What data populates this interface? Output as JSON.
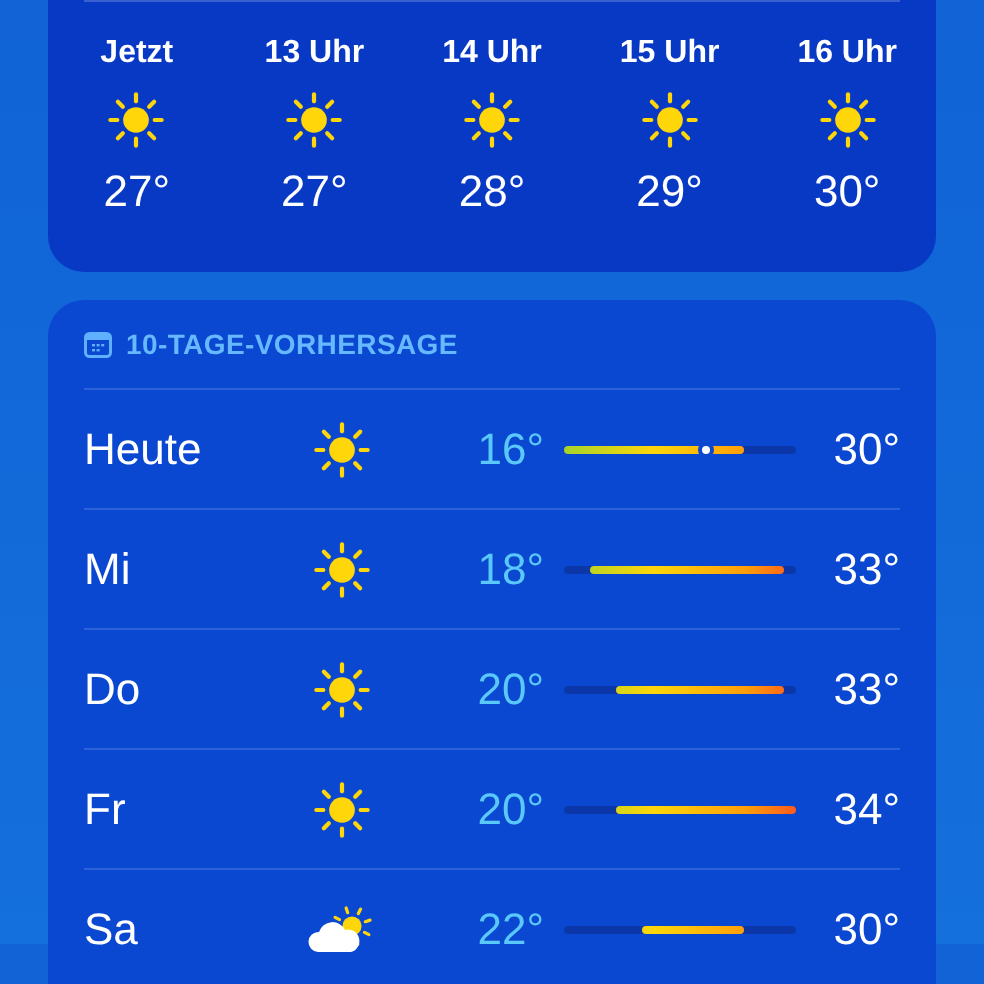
{
  "hourly": [
    {
      "time": "Jetzt",
      "kind": "sun",
      "temp": "27°"
    },
    {
      "time": "13 Uhr",
      "kind": "sun",
      "temp": "27°"
    },
    {
      "time": "14 Uhr",
      "kind": "sun",
      "temp": "28°"
    },
    {
      "time": "15 Uhr",
      "kind": "sun",
      "temp": "29°"
    },
    {
      "time": "16 Uhr",
      "kind": "sun",
      "temp": "30°"
    }
  ],
  "forecast": {
    "title": "10-TAGE-VORHERSAGE",
    "days": [
      {
        "day": "Heute",
        "kind": "sun",
        "low": "16°",
        "high": "30°",
        "current": {
          "level": 0.61
        }
      },
      {
        "day": "Mi",
        "kind": "sun",
        "low": "18°",
        "high": "33°"
      },
      {
        "day": "Do",
        "kind": "sun",
        "low": "20°",
        "high": "33°"
      },
      {
        "day": "Fr",
        "kind": "sun",
        "low": "20°",
        "high": "34°"
      },
      {
        "day": "Sa",
        "kind": "partly_cloudy",
        "low": "22°",
        "high": "30°"
      }
    ]
  }
}
